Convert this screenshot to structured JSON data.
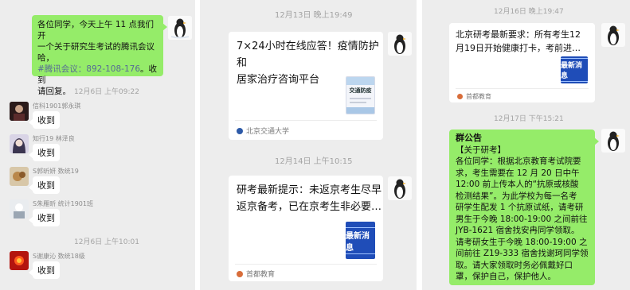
{
  "left_panel": {
    "notice": {
      "line1": "各位同学，今天上午 11 点我们开",
      "line2": "一个关于研究生考试的腾讯会议",
      "line3": "哈，",
      "line4_link": "#腾讯会议：892-108-176",
      "line4_rest": "。收到",
      "line5": "请回复。"
    },
    "timestamp_1": "12月6日 上午09:22",
    "replies": [
      {
        "name": "信科1901郭永琪",
        "text": "收到"
      },
      {
        "name": "知行19 林泽良",
        "text": "收到"
      },
      {
        "name": "S郭昕妍 数统19",
        "text": "收到"
      },
      {
        "name": "S朱雁昕 统计1901班",
        "text": "收到"
      }
    ],
    "timestamp_2": "12月6日 上午10:01",
    "last_reply": {
      "name": "S谢康沁 数统18级",
      "text": "收到"
    }
  },
  "middle_panel": {
    "timestamp_1": "12月13日 晚上19:49",
    "card_1": {
      "title_line1": "7×24小时在线应答！疫情防护和",
      "title_line2": "居家治疗咨询平台",
      "thumb_text": "交通防疫",
      "source": "北京交通大学"
    },
    "timestamp_2": "12月14日 上午10:15",
    "card_2": {
      "title_line1": "研考最新提示：未返京考生尽早",
      "title_line2": "返京备考，已在京考生非必要…",
      "thumb_text": "最新消息",
      "source": "首都教育"
    }
  },
  "right_panel": {
    "timestamp_top": "12月16日 晚上19:47",
    "card": {
      "title_line1": "北京研考最新要求：所有考生12",
      "title_line2": "月19日开始健康打卡，考前进…",
      "thumb_text": "最新消息",
      "source": "首都教育"
    },
    "timestamp_2": "12月17日 下午15:21",
    "announcement": {
      "heading": "群公告",
      "lines": [
        "【关于研考】",
        "各位同学：根据北京教育考试院要",
        "求，考生需要在 12 月 20 日中午",
        "12:00 前上传本人的“抗原或核酸",
        "检测结果”。为此学校为每一名考",
        "研学生配发 1 个抗原试纸，请考研",
        "男生于今晚 18:00-19:00 之间前往",
        "JYB-1621 宿舍找安冉同学领取。",
        "请考研女生于今晚 18:00-19:00 之",
        "间前往 Z19-333 宿舍找谢珂同学领",
        "取。请大家领取时务必佩戴好口",
        "罩，保护自己，保护他人。"
      ]
    }
  },
  "colors": {
    "chat_bg": "#ededed",
    "bubble_green": "#95ec69",
    "link_blue": "#576b95",
    "news_blue": "#1f4db8"
  }
}
